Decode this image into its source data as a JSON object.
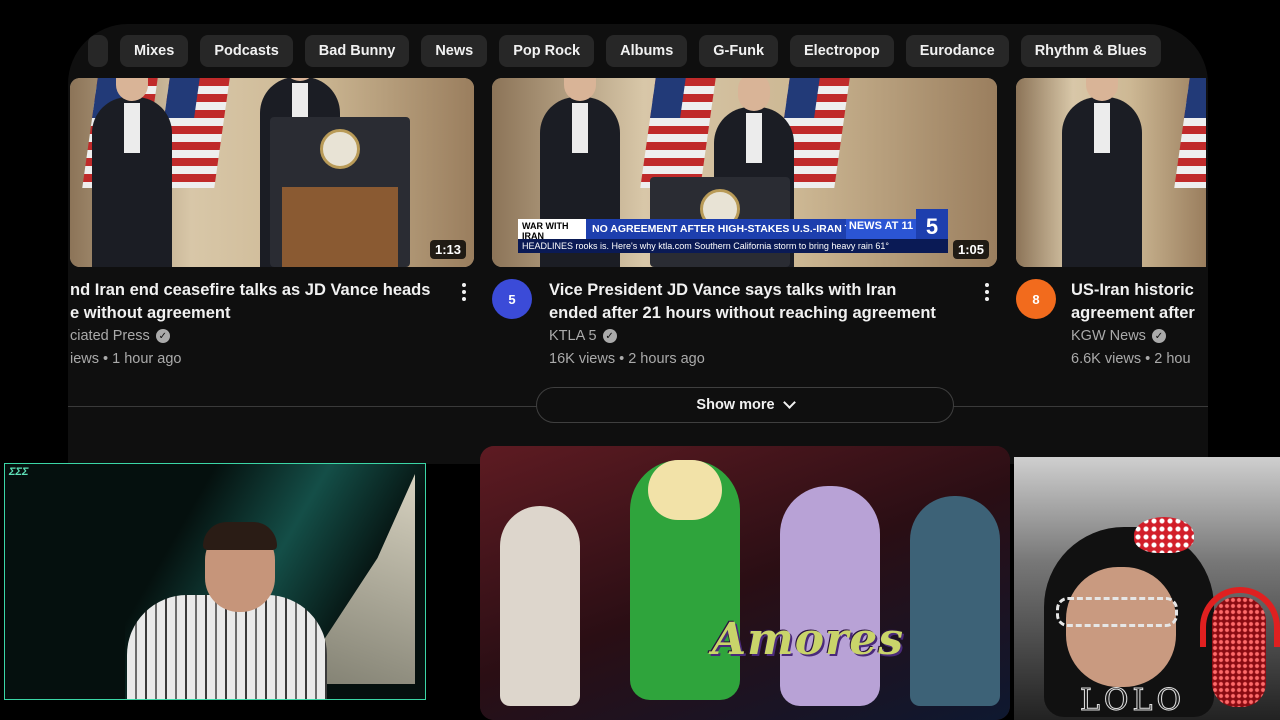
{
  "chips": [
    "Mixes",
    "Podcasts",
    "Bad Bunny",
    "News",
    "Pop Rock",
    "Albums",
    "G-Funk",
    "Electropop",
    "Eurodance",
    "Rhythm & Blues"
  ],
  "videos": [
    {
      "title_line1": "nd Iran end ceasefire talks as JD Vance heads",
      "title_line2": "e without agreement",
      "channel": "ciated Press",
      "views": "iews • 1 hour ago",
      "duration": "1:13"
    },
    {
      "title_line1": "Vice President JD Vance says talks with Iran",
      "title_line2": "ended after 21 hours without reaching agreement",
      "channel": "KTLA 5",
      "views": "16K views • 2 hours ago",
      "duration": "1:05",
      "avatar_text": "5",
      "overlay": {
        "tag": "WAR WITH IRAN",
        "headline": "NO AGREEMENT AFTER HIGH-STAKES U.S.-IRAN TALKS",
        "news": "NEWS AT 11",
        "channel_logo": "5",
        "ticker": "HEADLINES  rooks is. Here's why  ktla.com  Southern California storm to bring heavy rain  61°"
      }
    },
    {
      "title_line1": "US-Iran historic",
      "title_line2": "agreement after",
      "channel": "KGW News",
      "views": "6.6K views • 2 hou",
      "avatar_text": "8"
    }
  ],
  "show_more": {
    "label": "Show more"
  },
  "overlays": {
    "music_title": "Amores",
    "streamer_name": "LOLO",
    "left_cam_logo": "ΣΣΣ"
  },
  "colors": {
    "page_bg": "#0f0f0f",
    "chip_bg": "#272727",
    "cam_border": "#3bd6a6",
    "kgw_orange": "#f26b1d",
    "ktla_blue": "#3b4bd8"
  },
  "icons": [
    "verified-check-icon",
    "more-vert-icon",
    "chevron-down-icon"
  ]
}
